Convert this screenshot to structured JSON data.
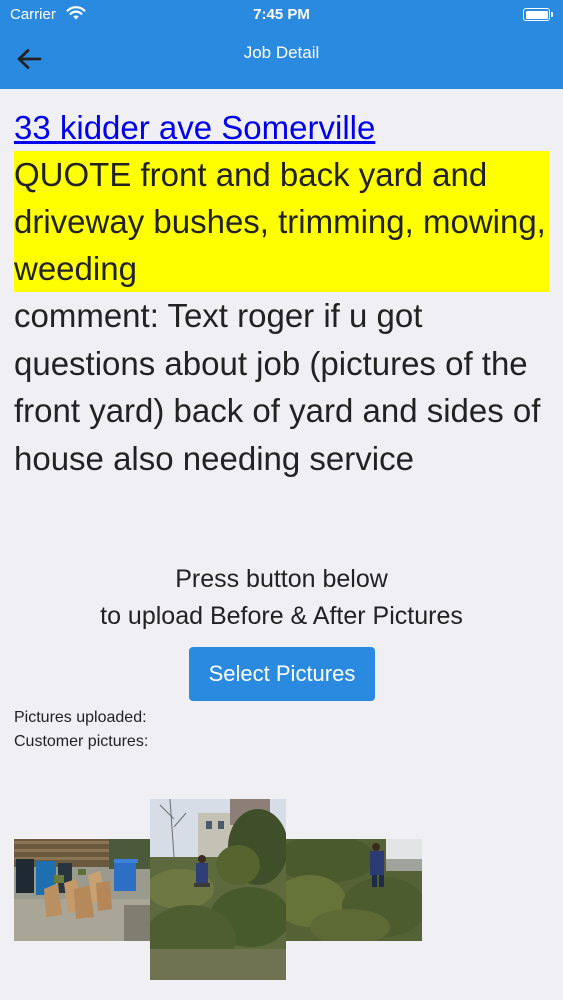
{
  "status_bar": {
    "carrier": "Carrier",
    "time": "7:45 PM"
  },
  "nav": {
    "title": "Job Detail",
    "back_icon": "arrow-left-icon"
  },
  "job": {
    "address": "33 kidder ave Somerville",
    "quote": "QUOTE front and back yard and driveway bushes, trimming, mowing, weeding",
    "comment": "comment: Text roger if u got questions about job (pictures of the front yard)  back of yard and sides of house also needing service"
  },
  "upload": {
    "instruction_line1": "Press button below",
    "instruction_line2": "to upload Before & After Pictures",
    "button_label": "Select Pictures",
    "pictures_uploaded_label": "Pictures uploaded:",
    "customer_pictures_label": "Customer pictures:"
  },
  "colors": {
    "header": "#2a8ae0",
    "button": "#2a8ae0",
    "highlight": "#ffff00",
    "link": "#0000ee",
    "background": "#efeff4"
  }
}
